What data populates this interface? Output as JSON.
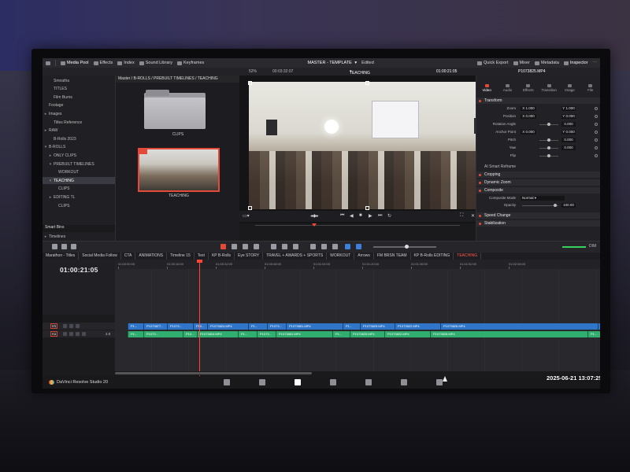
{
  "topbar": {
    "items": [
      "Media Pool",
      "Effects",
      "Index",
      "Sound Library",
      "Keyframes"
    ],
    "project_title": "MASTER - TEMPLATE",
    "edited": "Edited",
    "right_items": [
      "Quick Export",
      "Mixer",
      "Metadata",
      "Inspector"
    ]
  },
  "viewer_bar": {
    "zoom": "52%",
    "duration": "00:03:32:07",
    "timeline_name": "TEACHING",
    "timecode": "01:00:21:05",
    "clip_name": "P1073825.MP4"
  },
  "sidebar": {
    "items": [
      {
        "label": "Smnatha",
        "indent": 1,
        "caret": ""
      },
      {
        "label": "TITLES",
        "indent": 1,
        "caret": ""
      },
      {
        "label": "Film Burns",
        "indent": 1,
        "caret": ""
      },
      {
        "label": "Footage",
        "indent": 0,
        "caret": ""
      },
      {
        "label": "Images",
        "indent": 0,
        "caret": "▸"
      },
      {
        "label": "Titles Reference",
        "indent": 1,
        "caret": ""
      },
      {
        "label": "RAW",
        "indent": 0,
        "caret": "▸"
      },
      {
        "label": "B-Rolls 2023",
        "indent": 1,
        "caret": ""
      },
      {
        "label": "B-ROLLS",
        "indent": 0,
        "caret": "▾"
      },
      {
        "label": "ONLY CLIPS",
        "indent": 1,
        "caret": "▸"
      },
      {
        "label": "PREBUILT TIMELINES",
        "indent": 1,
        "caret": "▾"
      },
      {
        "label": "WORKOUT",
        "indent": 2,
        "caret": ""
      },
      {
        "label": "TEACHING",
        "indent": 1,
        "caret": "▾",
        "selected": true
      },
      {
        "label": "CLIPS",
        "indent": 2,
        "caret": ""
      },
      {
        "label": "EDITING TL",
        "indent": 1,
        "caret": "▸"
      },
      {
        "label": "CLIPS",
        "indent": 2,
        "caret": ""
      }
    ],
    "smart_bins": "Smart Bins",
    "timelines": "Timelines"
  },
  "mediapool": {
    "path": "Master / B-ROLLS / PREBUILT TIMELINES / TEACHING",
    "folder_label": "CLIPS",
    "timeline_label": "TEACHING"
  },
  "inspector": {
    "tabs": [
      "Video",
      "Audio",
      "Effects",
      "Transition",
      "Image",
      "File"
    ],
    "sections": {
      "transform": "Transform",
      "smart_reframe": "AI Smart Reframe",
      "cropping": "Cropping",
      "dynamic_zoom": "Dynamic Zoom",
      "composite": "Composite",
      "speed_change": "Speed Change",
      "stabilization": "Stabilization"
    },
    "props": [
      {
        "label": "Zoom",
        "x": "X 1.000",
        "y": "Y 1.000"
      },
      {
        "label": "Position",
        "x": "X 0.000",
        "y": "Y 0.000"
      },
      {
        "label": "Rotation Angle",
        "x": "",
        "y": "0.000"
      },
      {
        "label": "Anchor Point",
        "x": "X 0.000",
        "y": "Y 0.000"
      },
      {
        "label": "Pitch",
        "x": "",
        "y": "0.000"
      },
      {
        "label": "Yaw",
        "x": "",
        "y": "0.000"
      },
      {
        "label": "Flip",
        "x": "",
        "y": ""
      }
    ],
    "composite_mode_label": "Composite Mode",
    "composite_mode": "Normal",
    "opacity_label": "Opacity",
    "opacity": "100.00"
  },
  "toolbar": {
    "volume_label": "DIM"
  },
  "timeline_tabs": [
    "Marathon - Titles",
    "Social Media Follow",
    "CTA",
    "ANIMATIONS",
    "Timeline 15",
    "Text",
    "KP B-Rolls",
    "Eye STORY",
    "TRAVEL + AWARDS + SPORTS",
    "WORKOUT",
    "Arrows",
    "FM BRSN TEAM",
    "KP B-Rolls EDITING",
    "TEACHING"
  ],
  "active_timeline_tab": "TEACHING",
  "timeline": {
    "timecode": "01:00:21:05",
    "ruler": [
      "01:00:00:00",
      "01:00:16:00",
      "01:00:32:00",
      "01:00:48:00",
      "01:01:04:00",
      "01:01:20:00",
      "01:01:36:00",
      "01:01:52:00",
      "01:02:08:00"
    ],
    "v1_label": "V1",
    "a1_label": "A1",
    "a1_level": "2.0",
    "v1_clips": [
      "P1...",
      "P1073877...",
      "P1073...",
      "P10...",
      "P1073824.MP4",
      "P1...",
      "P1073...",
      "P1073851.MP4",
      "P1...",
      "P1073825.MP4",
      "P1073822.MP4",
      "P1073826.MP4",
      "P1..."
    ],
    "a1_clips": [
      "P1...",
      "P1073...",
      "P10...",
      "P1073824.MP4",
      "P1...",
      "P1073...",
      "P1073851.MP4",
      "P1...",
      "P1073825.MP4",
      "P1073822.MP4",
      "P1073826.MP4",
      "P1..."
    ]
  },
  "bottom": {
    "app_name": "DaVinci Resolve Studio 20",
    "pages": [
      "media-page-icon",
      "cut-page-icon",
      "edit-page-icon",
      "fusion-page-icon",
      "color-page-icon",
      "fairlight-page-icon",
      "deliver-page-icon"
    ],
    "active_page": "edit-page-icon"
  },
  "datetime": "2025-06-21  13:07:25"
}
